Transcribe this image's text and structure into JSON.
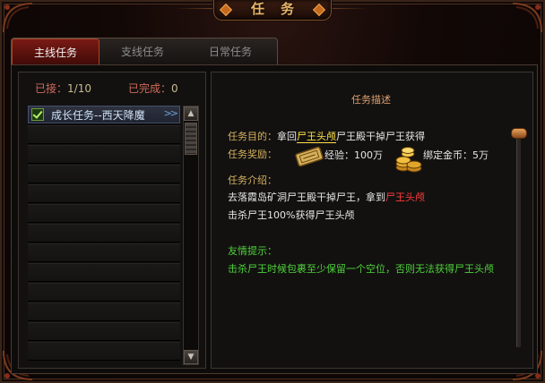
{
  "window": {
    "title": "任务"
  },
  "tabs": [
    {
      "label": "主线任务",
      "active": true
    },
    {
      "label": "支线任务",
      "active": false
    },
    {
      "label": "日常任务",
      "active": false
    }
  ],
  "stats": {
    "accepted_label": "已接：",
    "accepted_value": "1/10",
    "completed_label": "已完成：",
    "completed_value": "0"
  },
  "quest_list": {
    "items": [
      {
        "label": "成长任务--西天降魔",
        "selected": true,
        "checked": true,
        "arrow": ">>"
      }
    ],
    "empty_rows": 12
  },
  "detail": {
    "header": "任务描述",
    "goal_label": "任务目的：",
    "goal_prefix": "拿回",
    "goal_item": "尸王头颅",
    "goal_suffix": "尸王殿干掉尸王获得",
    "reward_label": "任务奖励：",
    "reward_exp": "经验：100万",
    "reward_gold": "绑定金币：5万",
    "intro_label": "任务介绍：",
    "intro_line1_a": "去落霞岛矿洞尸王殿干掉尸王，拿到",
    "intro_line1_item": "尸王头颅",
    "intro_line2": "击杀尸王100%获得尸王头颅",
    "tip_label": "友情提示：",
    "tip_text": "击杀尸王时候包裹至少保留一个空位，否则无法获得尸王头颅"
  },
  "colors": {
    "accent_red": "#7a1a14",
    "title_gold": "#e8b56a",
    "label_gold": "#d6b060",
    "tip_green": "#4fd13a",
    "item_red": "#ff3a3a",
    "item_yellow": "#ffe24a"
  },
  "icons": [
    "check-icon",
    "double-arrow-icon",
    "scroll-up-icon",
    "scroll-down-icon",
    "ticket-icon",
    "gold-coins-icon"
  ]
}
